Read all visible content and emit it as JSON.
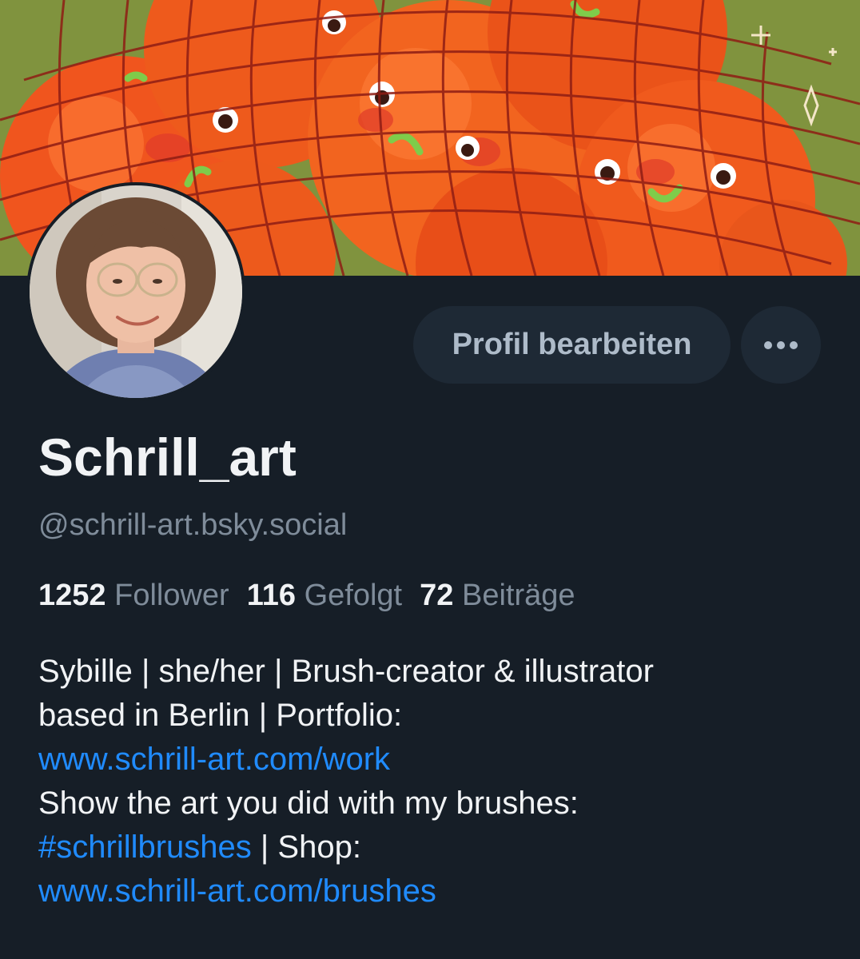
{
  "profile": {
    "display_name": "Schrill_art",
    "handle": "@schrill-art.bsky.social",
    "stats": {
      "followers_count": "1252",
      "followers_label": "Follower",
      "following_count": "116",
      "following_label": "Gefolgt",
      "posts_count": "72",
      "posts_label": "Beiträge"
    },
    "bio": {
      "line1": "Sybille | she/her | Brush-creator & illustrator",
      "line2": "based in Berlin | Portfolio:",
      "portfolio_link": "www.schrill-art.com/work",
      "line4": " Show the art you did with my brushes:",
      "hashtag": "#schrillbrushes",
      "shop_text": " | Shop:",
      "shop_link": "www.schrill-art.com/brushes"
    }
  },
  "actions": {
    "edit_profile_label": "Profil bearbeiten",
    "more_icon": "more-horizontal-icon"
  },
  "banner": {
    "description_icon": "banner-image"
  },
  "colors": {
    "background": "#161e27",
    "button_bg": "#1e2935",
    "link": "#208bfe",
    "muted_text": "#7f8c9a",
    "primary_text": "#f1f3f5"
  }
}
